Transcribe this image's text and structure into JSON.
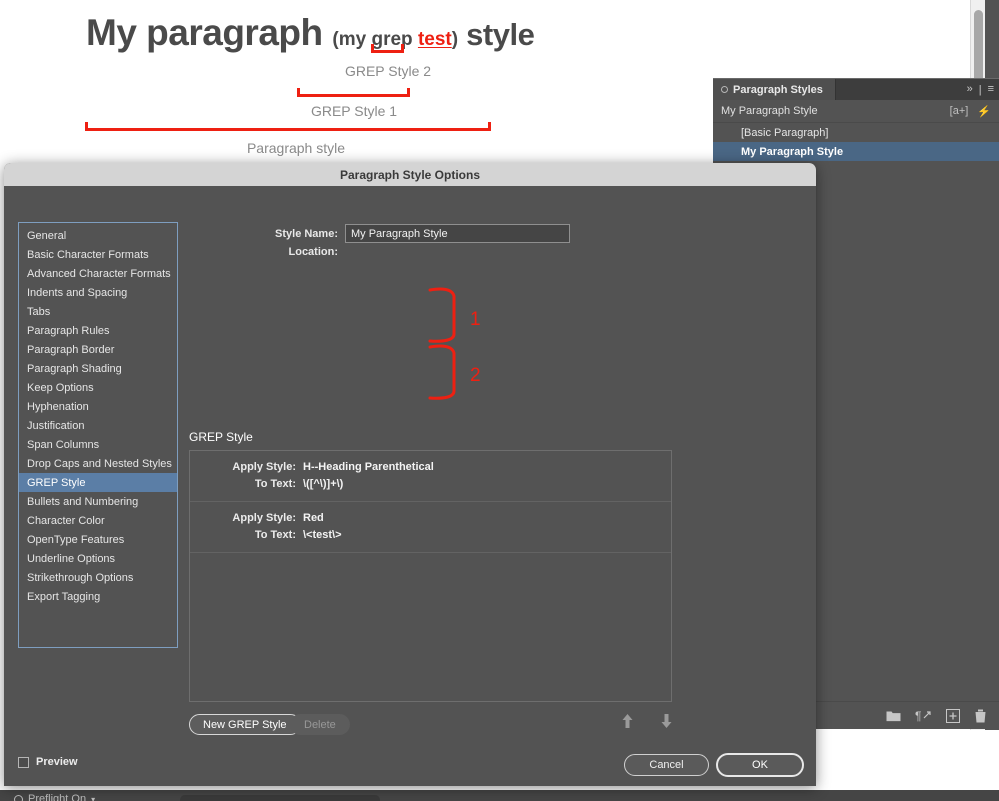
{
  "document": {
    "headline": {
      "part_main": "My paragraph ",
      "part_paren_open": "(my grep ",
      "part_test": "test",
      "part_paren_close": ")",
      "part_style": " style"
    },
    "annotations": [
      {
        "label": "GREP Style 2"
      },
      {
        "label": "GREP Style 1"
      },
      {
        "label": "Paragraph style"
      }
    ]
  },
  "styles_panel": {
    "tab_label": "Paragraph Styles",
    "collapse_icon": "»",
    "divider": "|",
    "menu_icon": "≡",
    "current_style": "My Paragraph Style",
    "badge_a_plus": "[a+]",
    "clear_override_icon": "⚡",
    "items": [
      {
        "label": "[Basic Paragraph]",
        "selected": false
      },
      {
        "label": "My Paragraph Style",
        "selected": true
      }
    ],
    "footer_icons": [
      "folder-icon",
      "clear-overrides-icon",
      "new-style-icon",
      "delete-style-icon"
    ]
  },
  "statusbar": {
    "preflight_label": "Preflight On",
    "caret": "▾"
  },
  "dialog": {
    "title": "Paragraph Style Options",
    "categories": [
      {
        "label": "General",
        "selected": false
      },
      {
        "label": "Basic Character Formats",
        "selected": false
      },
      {
        "label": "Advanced Character Formats",
        "selected": false
      },
      {
        "label": "Indents and Spacing",
        "selected": false
      },
      {
        "label": "Tabs",
        "selected": false
      },
      {
        "label": "Paragraph Rules",
        "selected": false
      },
      {
        "label": "Paragraph Border",
        "selected": false
      },
      {
        "label": "Paragraph Shading",
        "selected": false
      },
      {
        "label": "Keep Options",
        "selected": false
      },
      {
        "label": "Hyphenation",
        "selected": false
      },
      {
        "label": "Justification",
        "selected": false
      },
      {
        "label": "Span Columns",
        "selected": false
      },
      {
        "label": "Drop Caps and Nested Styles",
        "selected": false
      },
      {
        "label": "GREP Style",
        "selected": true
      },
      {
        "label": "Bullets and Numbering",
        "selected": false
      },
      {
        "label": "Character Color",
        "selected": false
      },
      {
        "label": "OpenType Features",
        "selected": false
      },
      {
        "label": "Underline Options",
        "selected": false
      },
      {
        "label": "Strikethrough Options",
        "selected": false
      },
      {
        "label": "Export Tagging",
        "selected": false
      }
    ],
    "style_name_label": "Style Name:",
    "style_name_value": "My Paragraph Style",
    "location_label": "Location:",
    "location_value": "",
    "section_title": "GREP Style",
    "grep_entries": [
      {
        "apply_style_label": "Apply Style:",
        "apply_style_value": "H--Heading Parenthetical",
        "to_text_label": "To Text:",
        "to_text_value": "\\([^\\)]+\\)",
        "annotation_number": "1"
      },
      {
        "apply_style_label": "Apply Style:",
        "apply_style_value": "Red",
        "to_text_label": "To Text:",
        "to_text_value": "\\<test\\>",
        "annotation_number": "2"
      }
    ],
    "new_grep_style_label": "New GREP Style",
    "delete_label": "Delete",
    "move_up_icon": "⬆",
    "move_down_icon": "⬇",
    "preview_label": "Preview",
    "cancel_label": "Cancel",
    "ok_label": "OK"
  },
  "colors": {
    "dialog_bg": "#535353",
    "titlebar_bg": "#d4d4d4",
    "selection_blue": "#5b7ea6",
    "panel_selection_blue": "#4a6785",
    "annotation_red": "#ee2012",
    "text_light": "#e8e8e8"
  }
}
